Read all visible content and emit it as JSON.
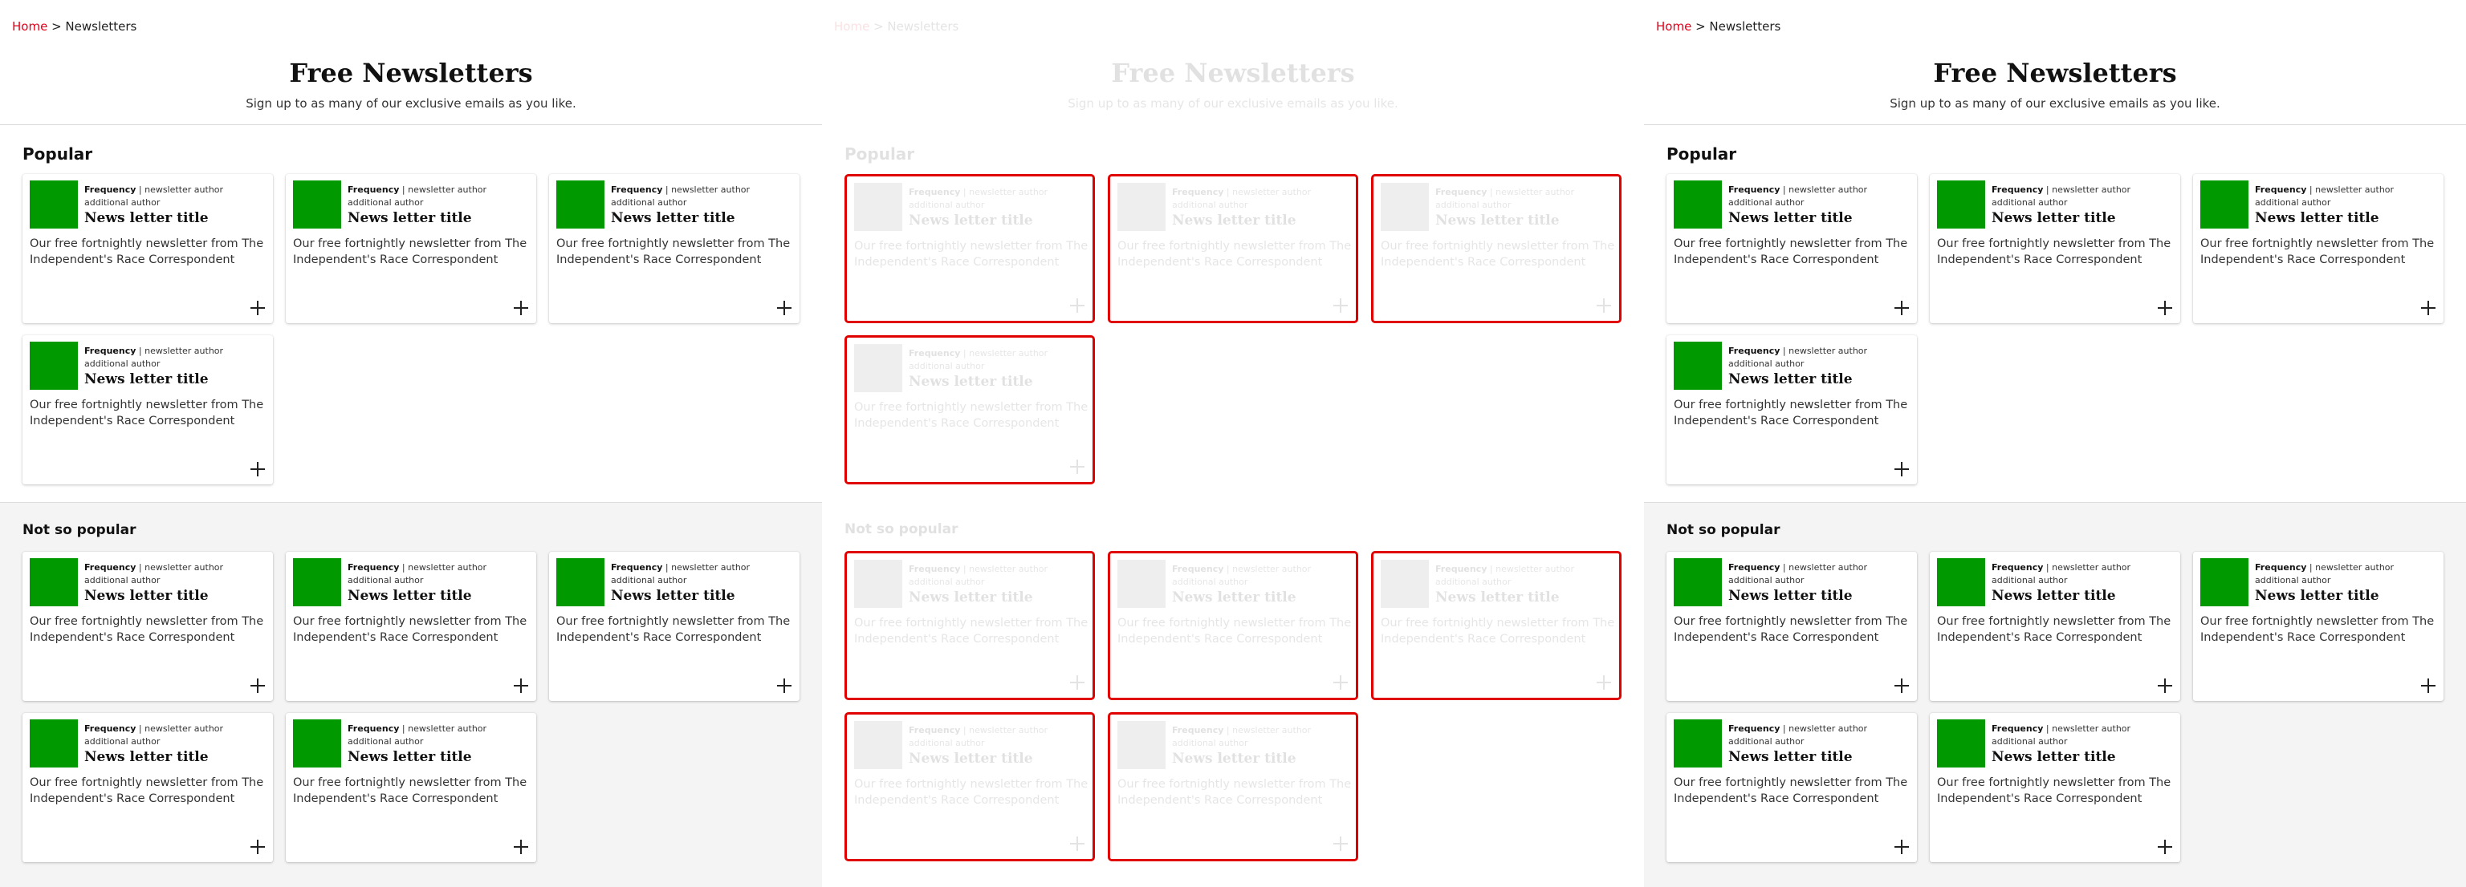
{
  "breadcrumb": {
    "home": "Home",
    "separator": ">",
    "current": "Newsletters"
  },
  "header": {
    "title": "Free Newsletters",
    "subtitle": "Sign up to as many of our exclusive emails as you like."
  },
  "sections": {
    "popular": {
      "heading": "Popular"
    },
    "not_popular": {
      "heading": "Not so popular"
    }
  },
  "card": {
    "frequency": "Frequency",
    "separator": "|",
    "author": "newsletter author",
    "additional_author": "additional author",
    "title": "News letter title",
    "description": "Our free fortnightly newsletter from The Independent's Race Correspondent"
  },
  "colors": {
    "accent": "#e4001b",
    "thumb": "#009900",
    "highlight": "#e00000"
  }
}
